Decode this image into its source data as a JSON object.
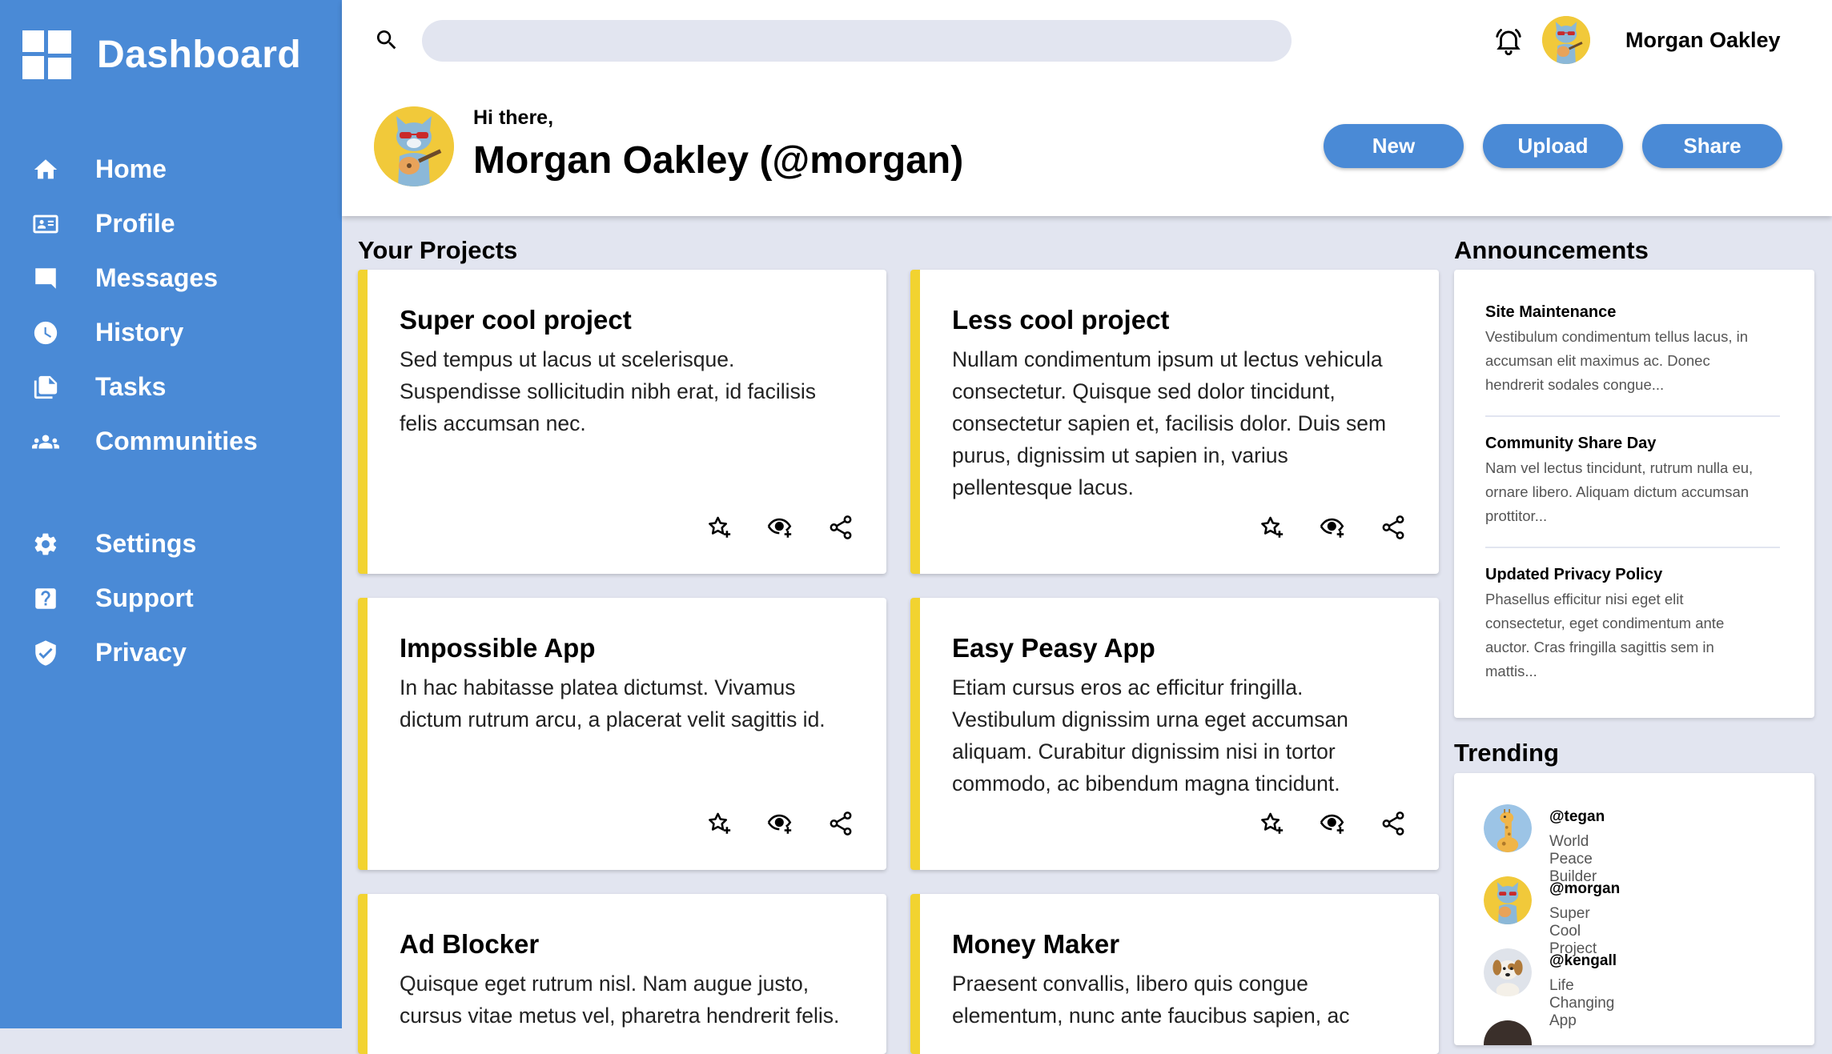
{
  "app": {
    "title": "Dashboard"
  },
  "sidebar": {
    "items": [
      {
        "label": "Home",
        "icon": "home-icon"
      },
      {
        "label": "Profile",
        "icon": "profile-card-icon"
      },
      {
        "label": "Messages",
        "icon": "message-icon"
      },
      {
        "label": "History",
        "icon": "clock-icon"
      },
      {
        "label": "Tasks",
        "icon": "documents-icon"
      },
      {
        "label": "Communities",
        "icon": "people-icon"
      }
    ],
    "secondary_items": [
      {
        "label": "Settings",
        "icon": "gear-icon"
      },
      {
        "label": "Support",
        "icon": "help-icon"
      },
      {
        "label": "Privacy",
        "icon": "shield-icon"
      }
    ]
  },
  "header": {
    "search": {
      "value": "",
      "placeholder": ""
    },
    "username": "Morgan Oakley"
  },
  "hero": {
    "greeting": "Hi there,",
    "name": "Morgan Oakley (@morgan)",
    "buttons": {
      "new": "New",
      "upload": "Upload",
      "share": "Share"
    }
  },
  "projects": {
    "title": "Your Projects",
    "items": [
      {
        "title": "Super cool project",
        "lines": [
          "Sed tempus ut lacus ut scelerisque.",
          "Suspendisse sollicitudin nibh erat, id facilisis",
          "felis accumsan nec."
        ]
      },
      {
        "title": "Less cool project",
        "lines": [
          "Nullam condimentum ipsum ut lectus vehicula",
          "consectetur. Quisque sed dolor tincidunt,",
          "consectetur sapien et, facilisis dolor. Duis sem",
          "purus, dignissim ut sapien in, varius",
          "pellentesque lacus."
        ]
      },
      {
        "title": "Impossible App",
        "lines": [
          "In hac habitasse platea dictumst. Vivamus",
          "dictum rutrum arcu, a placerat velit sagittis id."
        ]
      },
      {
        "title": "Easy Peasy App",
        "lines": [
          "Etiam cursus eros ac efficitur fringilla.",
          "Vestibulum dignissim urna eget accumsan",
          "aliquam. Curabitur dignissim nisi in tortor",
          "commodo, ac bibendum magna tincidunt."
        ]
      },
      {
        "title": "Ad Blocker",
        "lines": [
          "Quisque eget rutrum nisl. Nam augue justo,",
          "cursus vitae metus vel, pharetra hendrerit felis."
        ]
      },
      {
        "title": "Money Maker",
        "lines": [
          "Praesent convallis, libero quis congue",
          "elementum, nunc ante faucibus sapien, ac"
        ]
      }
    ]
  },
  "announcements": {
    "title": "Announcements",
    "items": [
      {
        "title": "Site Maintenance",
        "lines": [
          "Vestibulum condimentum tellus lacus, in",
          "accumsan elit maximus ac. Donec",
          "hendrerit sodales congue..."
        ]
      },
      {
        "title": "Community Share Day",
        "lines": [
          "Nam vel lectus tincidunt, rutrum nulla eu,",
          "ornare libero. Aliquam dictum accumsan",
          "prottitor..."
        ]
      },
      {
        "title": "Updated Privacy Policy",
        "lines": [
          "Phasellus efficitur nisi eget elit",
          "consectetur, eget condimentum ante",
          "auctor. Cras fringilla sagittis sem in",
          "mattis..."
        ]
      }
    ]
  },
  "trending": {
    "title": "Trending",
    "items": [
      {
        "handle": "@tegan",
        "subtitle": "World Peace Builder",
        "avatar": "giraffe-avatar"
      },
      {
        "handle": "@morgan",
        "subtitle": "Super Cool Project",
        "avatar": "cat-avatar"
      },
      {
        "handle": "@kengall",
        "subtitle": "Life Changing App",
        "avatar": "dog-avatar"
      }
    ]
  },
  "colors": {
    "accent": "#4a8ad6",
    "card_stripe": "#f2d330",
    "background": "#e2e5f0",
    "avatar_yellow": "#f1c93a"
  }
}
